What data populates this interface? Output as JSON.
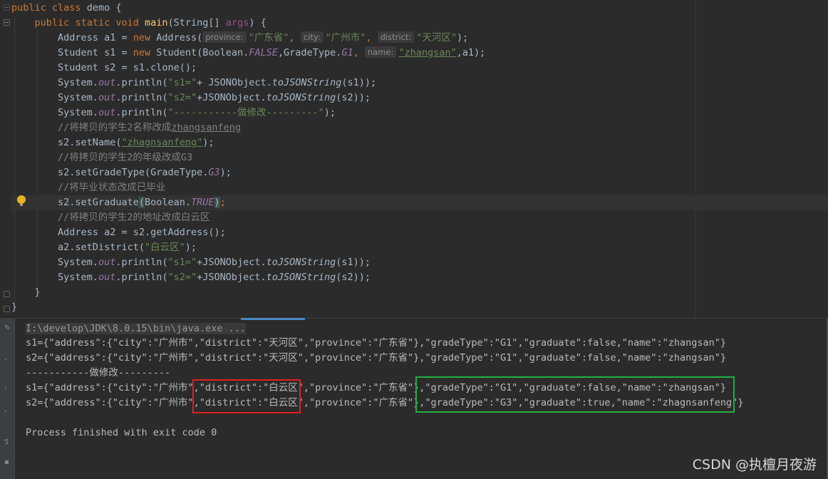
{
  "code": {
    "class_decl": {
      "kw1": "public",
      "kw2": "class",
      "name": "demo",
      "brace": "{"
    },
    "main_decl": {
      "kw1": "public",
      "kw2": "static",
      "kw3": "void",
      "method": "main",
      "sig1": "(String[] ",
      "param": "args",
      "sig2": ") {"
    },
    "l3": {
      "t1": "Address ",
      "var": "a1",
      "t2": " = ",
      "kw": "new",
      "t3": " Address(",
      "h1": "province:",
      "s1": "\"广东省\"",
      "c1": ",",
      "h2": "city:",
      "s2": "\"广州市\"",
      "c2": ",",
      "h3": "district:",
      "s3": "\"天河区\"",
      "end": ");"
    },
    "l4": {
      "t1": "Student ",
      "var": "s1",
      "t2": " = ",
      "kw": "new",
      "t3": " Student(Boolean.",
      "f1": "FALSE",
      "t4": ",GradeType.",
      "f2": "G1",
      "c1": ",",
      "h1": "name:",
      "s1": "\"zhangsan\"",
      "end": ",a1);"
    },
    "l5": {
      "t1": "Student ",
      "var": "s2",
      "t2": " = ",
      "var2": "s1",
      "t3": ".clone();"
    },
    "l6": {
      "t1": "System.",
      "f": "out",
      "t2": ".println(",
      "s": "\"s1=\"",
      "t3": "+ JSONObject.",
      "m": "toJSONString",
      "t4": "(",
      "v": "s1",
      "t5": "));"
    },
    "l7": {
      "t1": "System.",
      "f": "out",
      "t2": ".println(",
      "s": "\"s2=\"",
      "t3": "+JSONObject.",
      "m": "toJSONString",
      "t4": "(",
      "v": "s2",
      "t5": "));"
    },
    "l8": {
      "t1": "System.",
      "f": "out",
      "t2": ".println(",
      "s": "\"-----------做修改---------\"",
      "t3": ");"
    },
    "l9": {
      "c": "//将拷贝的学生2名称改成",
      "cu": "zhangsanfeng"
    },
    "l10": {
      "v": "s2",
      "t1": ".setName(",
      "s": "\"zhagnsanfeng\"",
      "t2": ");"
    },
    "l11": {
      "c": "//将拷贝的学生2的年级改成G3"
    },
    "l12": {
      "v": "s2",
      "t1": ".setGradeType(GradeType.",
      "f": "G3",
      "t2": ");"
    },
    "l13": {
      "c": "//将毕业状态改成已毕业"
    },
    "l14": {
      "v": "s2",
      "t1": ".setGraduate",
      "p1": "(",
      "t2": "Boolean.",
      "f": "TRUE",
      "p2": ")",
      "t3": ";"
    },
    "l15": {
      "c": "//将拷贝的学生2的地址改成白云区"
    },
    "l16": {
      "t1": "Address ",
      "var": "a2",
      "t2": " = ",
      "v": "s2",
      "t3": ".getAddress();"
    },
    "l17": {
      "v": "a2",
      "t1": ".setDistrict(",
      "s": "\"白云区\"",
      "t2": ");"
    },
    "l18": {
      "t1": "System.",
      "f": "out",
      "t2": ".println(",
      "s": "\"s1=\"",
      "t3": "+JSONObject.",
      "m": "toJSONString",
      "t4": "(",
      "v": "s1",
      "t5": "));"
    },
    "l19": {
      "t1": "System.",
      "f": "out",
      "t2": ".println(",
      "s": "\"s2=\"",
      "t3": "+JSONObject.",
      "m": "toJSONString",
      "t4": "(",
      "v": "s2",
      "t5": "));"
    },
    "l20": "}",
    "l21": "}"
  },
  "console": {
    "command": "I:\\develop\\JDK\\8.0.15\\bin\\java.exe ...",
    "line1": "s1={\"address\":{\"city\":\"广州市\",\"district\":\"天河区\",\"province\":\"广东省\"},\"gradeType\":\"G1\",\"graduate\":false,\"name\":\"zhangsan\"}",
    "line2": "s2={\"address\":{\"city\":\"广州市\",\"district\":\"天河区\",\"province\":\"广东省\"},\"gradeType\":\"G1\",\"graduate\":false,\"name\":\"zhangsan\"}",
    "line3": "-----------做修改---------",
    "line4": "s1={\"address\":{\"city\":\"广州市\",\"district\":\"白云区\",\"province\":\"广东省\"},\"gradeType\":\"G1\",\"graduate\":false,\"name\":\"zhangsan\"}",
    "line5": "s2={\"address\":{\"city\":\"广州市\",\"district\":\"白云区\",\"province\":\"广东省\"},\"gradeType\":\"G3\",\"graduate\":true,\"name\":\"zhagnsanfeng\"}",
    "exit": "Process finished with exit code 0"
  },
  "watermark": "CSDN @执檀月夜游",
  "colors": {
    "keyword": "#cc7832",
    "string": "#6a8759",
    "comment": "#808080",
    "field": "#9876aa",
    "highlight_red": "#e02020",
    "highlight_green": "#20b040"
  }
}
